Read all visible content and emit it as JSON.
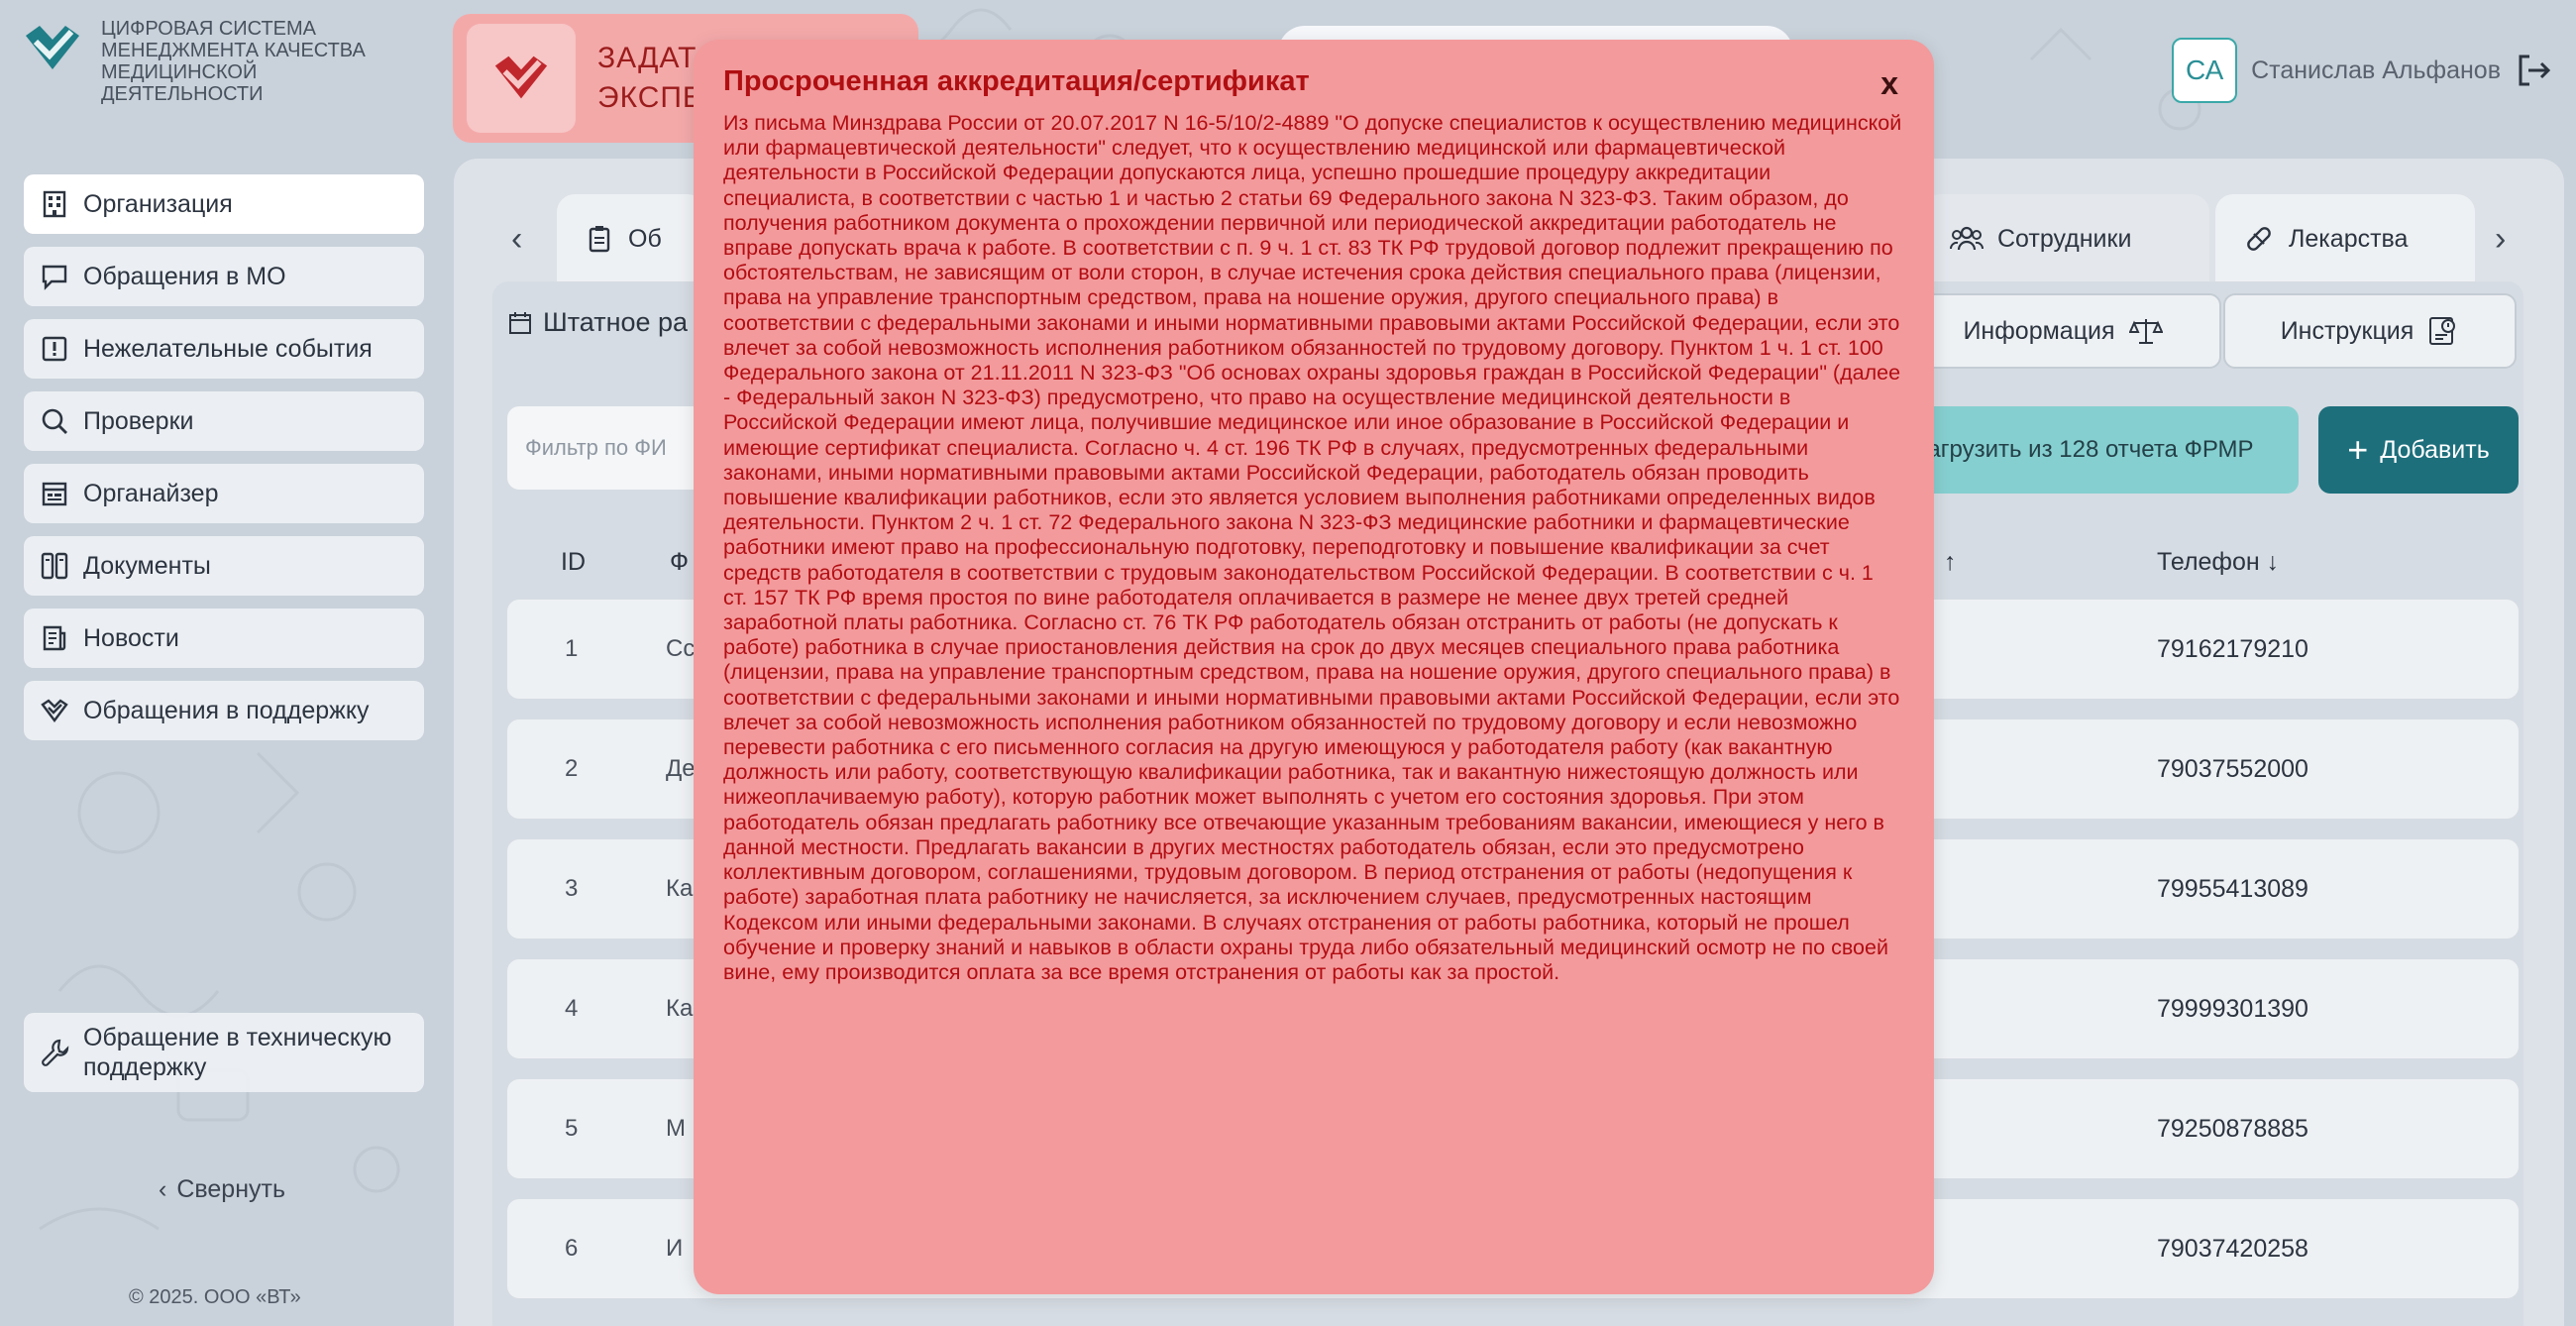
{
  "logo": {
    "text": "ЦИФРОВАЯ СИСТЕМА МЕНЕДЖМЕНТА КАЧЕСТВА МЕДИЦИНСКОЙ ДЕЯТЕЛЬНОСТИ"
  },
  "sidebar": {
    "items": [
      {
        "label": "Организация",
        "icon": "building-icon"
      },
      {
        "label": "Обращения в МО",
        "icon": "message-icon"
      },
      {
        "label": "Нежелательные события",
        "icon": "alert-icon"
      },
      {
        "label": "Проверки",
        "icon": "search-icon"
      },
      {
        "label": "Органайзер",
        "icon": "organizer-icon"
      },
      {
        "label": "Документы",
        "icon": "documents-icon"
      },
      {
        "label": "Новости",
        "icon": "news-icon"
      },
      {
        "label": "Обращения в поддержку",
        "icon": "support-check-icon"
      }
    ],
    "tech_support": "Обращение в техническую поддержку",
    "collapse": "Свернуть",
    "copyright": "© 2025. ООО «ВТ»"
  },
  "topbar": {
    "task_title_line1": "ЗАДАТ",
    "task_title_line2": "ЭКСПЕ",
    "user_initials": "СА",
    "user_name": "Станислав Альфанов"
  },
  "tabs": {
    "first_partial": "Об",
    "staff": "Сотрудники",
    "medicines": "Лекарства"
  },
  "content": {
    "staff_label": "Штатное ра",
    "info_button": "Информация",
    "instruction_button": "Инструкция",
    "filter_placeholder": "Фильтр по ФИ",
    "load_button": "агрузить из 128 отчета ФРМР",
    "add_button": "Добавить",
    "col_id": "ID",
    "col_name": "Ф",
    "col_sort_marker": "↑",
    "col_phone": "Телефон ↓",
    "rows": [
      {
        "id": "1",
        "name": "Сс",
        "phone": "79162179210"
      },
      {
        "id": "2",
        "name": "Де",
        "phone": "79037552000"
      },
      {
        "id": "3",
        "name": "Ка",
        "phone": "79955413089"
      },
      {
        "id": "4",
        "name": "Ка",
        "phone": "79999301390"
      },
      {
        "id": "5",
        "name": "М",
        "phone": "79250878885"
      },
      {
        "id": "6",
        "name": "И",
        "phone": "79037420258"
      }
    ]
  },
  "modal": {
    "title": "Просроченная аккредитация/сертификат",
    "close": "x",
    "body": "Из письма Минздрава России от 20.07.2017 N 16-5/10/2-4889 \"О допуске специалистов к осуществлению медицинской или фармацевтической деятельности\" следует, что к осуществлению медицинской или фармацевтической деятельности в Российской Федерации допускаются лица, успешно прошедшие процедуру аккредитации специалиста, в соответствии с частью 1 и частью 2 статьи 69 Федерального закона N 323-ФЗ. Таким образом, до получения работником документа о прохождении первичной или периодической аккредитации работодатель не вправе допускать врача к работе. В соответствии с п. 9 ч. 1 ст. 83 ТК РФ трудовой договор подлежит прекращению по обстоятельствам, не зависящим от воли сторон, в случае истечения срока действия специального права (лицензии, права на управление транспортным средством, права на ношение оружия, другого специального права) в соответствии с федеральными законами и иными нормативными правовыми актами Российской Федерации, если это влечет за собой невозможность исполнения работником обязанностей по трудовому договору. Пунктом 1 ч. 1 ст. 100 Федерального закона от 21.11.2011 N 323-ФЗ \"Об основах охраны здоровья граждан в Российской Федерации\" (далее - Федеральный закон N 323-ФЗ) предусмотрено, что право на осуществление медицинской деятельности в Российской Федерации имеют лица, получившие медицинское или иное образование в Российской Федерации и имеющие сертификат специалиста. Согласно ч. 4 ст. 196 ТК РФ в случаях, предусмотренных федеральными законами, иными нормативными правовыми актами Российской Федерации, работодатель обязан проводить повышение квалификации работников, если это является условием выполнения работниками определенных видов деятельности. Пунктом 2 ч. 1 ст. 72 Федерального закона N 323-ФЗ медицинские работники и фармацевтические работники имеют право на профессиональную подготовку, переподготовку и повышение квалификации за счет средств работодателя в соответствии с трудовым законодательством Российской Федерации. В соответствии с ч. 1 ст. 157 ТК РФ время простоя по вине работодателя оплачивается в размере не менее двух третей средней заработной платы работника. Согласно ст. 76 ТК РФ работодатель обязан отстранить от работы (не допускать к работе) работника в случае приостановления действия на срок до двух месяцев специального права работника (лицензии, права на управление транспортным средством, права на ношение оружия, другого специального права) в соответствии с федеральными законами и иными нормативными правовыми актами Российской Федерации, если это влечет за собой невозможность исполнения работником обязанностей по трудовому договору и если невозможно перевести работника с его письменного согласия на другую имеющуюся у работодателя работу (как вакантную должность или работу, соответствующую квалификации работника, так и вакантную нижестоящую должность или нижеоплачиваемую работу), которую работник может выполнять с учетом его состояния здоровья. При этом работодатель обязан предлагать работнику все отвечающие указанным требованиям вакансии, имеющиеся у него в данной местности. Предлагать вакансии в других местностях работодатель обязан, если это предусмотрено коллективным договором, соглашениями, трудовым договором. В период отстранения от работы (недопущения к работе) заработная плата работнику не начисляется, за исключением случаев, предусмотренных настоящим Кодексом или иными федеральными законами. В случаях отстранения от работы работника, который не прошел обучение и проверку знаний и навыков в области охраны труда либо обязательный медицинский осмотр не по своей вине, ему производится оплата за все время отстранения от работы как за простой."
  },
  "colors": {
    "accent_teal": "#1d6f7c",
    "modal_bg": "#f39a9c",
    "modal_text": "#b20d12",
    "brand_red": "#c0272d"
  }
}
